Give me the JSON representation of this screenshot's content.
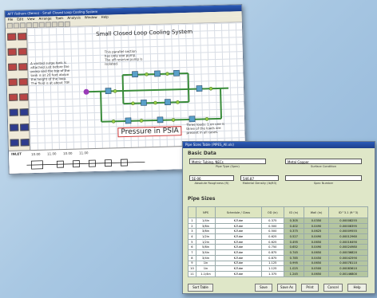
{
  "colors": {
    "accent": "#2b5bb8",
    "pipe": "#3a8c3a",
    "component": "#5aa0c8",
    "background": "#a9c8e3"
  },
  "win1": {
    "title": "AFT Fathom (Demo) - Small Closed Loop Cooling System",
    "menu": [
      "File",
      "Edit",
      "View",
      "Arrange",
      "Tools",
      "Analysis",
      "Window",
      "Help"
    ],
    "canvas_title": "Small Closed Loop Cooling System",
    "note_left": "A vented surge tank is attached just before the pump and the top of the tank is at 20 feet above the height of the loop. The fluid is at about 70F.",
    "note_top": "This parallel section has only one pump. The off reserve pump is isolated.",
    "note_bottom": "Three loads: 1 on one is three of the loads are present in all cases.",
    "psia_label": "Pressure in PSIA",
    "inlet_label": "INLET",
    "inlet_values": [
      "10.00",
      "11.00",
      "10.00",
      "11.00"
    ]
  },
  "win2": {
    "title": "Pipe Sizes Table (PIPES_All.xls)",
    "basic_data": "Basic Data",
    "material_value": "Metric Tubing, NECs",
    "material_label": "Pipe Type (Spec)",
    "roughness_value": "Metal Copper",
    "roughness_label": "Surface Condition",
    "abs_value": "5E-06",
    "abs_label": "Absolute Roughness (ft)",
    "density_value": "546.87",
    "density_label": "Material Density (lb/ft3)",
    "density2_label": "Spec Number",
    "pipe_sizes": "Pipe Sizes",
    "columns": [
      "",
      "NPS",
      "Schedule / Class",
      "OD (in)",
      "ID (in)",
      "Wall (in)",
      "ID^3.1 (ft^3)"
    ],
    "rows": [
      [
        "1",
        "1/4in",
        "K-Tube",
        "0.375",
        "0.305",
        "0.0350",
        "0.00008255"
      ],
      [
        "2",
        "3/8in",
        "K-Tube",
        "0.500",
        "0.402",
        "0.0490",
        "0.00008395"
      ],
      [
        "3",
        "3/8in",
        "K-Tube",
        "0.500",
        "0.375",
        "0.0625",
        "0.00009555"
      ],
      [
        "4",
        "1/2in",
        "K-Tube",
        "0.625",
        "0.527",
        "0.0490",
        "0.00012960"
      ],
      [
        "5",
        "1/2in",
        "K-Tube",
        "0.625",
        "0.495",
        "0.0650",
        "0.00016490"
      ],
      [
        "6",
        "5/8in",
        "K-Tube",
        "0.750",
        "0.652",
        "0.0490",
        "0.00024980"
      ],
      [
        "7",
        "3/4in",
        "K-Tube",
        "0.875",
        "0.745",
        "0.0650",
        "0.00036820"
      ],
      [
        "8",
        "3/4in",
        "K-Tube",
        "0.875",
        "0.785",
        "0.0450",
        "0.00042590"
      ],
      [
        "9",
        "1in",
        "K-Tube",
        "1.125",
        "0.995",
        "0.0650",
        "0.00078110"
      ],
      [
        "10",
        "1in",
        "K-Tube",
        "1.125",
        "1.025",
        "0.0500",
        "0.00083610"
      ],
      [
        "11",
        "1-1/4in",
        "K-Tube",
        "1.375",
        "1.245",
        "0.0650",
        "0.00146800"
      ]
    ],
    "buttons": {
      "sort": "Sort Table",
      "save": "Save",
      "save_as": "Save As",
      "print": "Print",
      "cancel": "Cancel",
      "help": "Help"
    }
  }
}
